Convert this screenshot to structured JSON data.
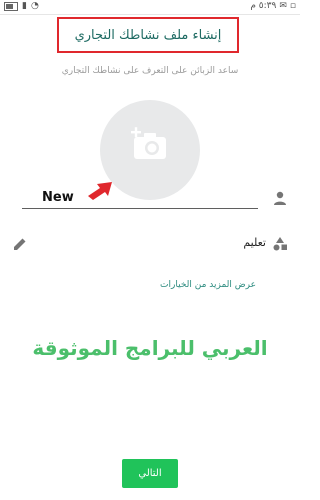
{
  "status_bar": {
    "time": "٥:٣٩ م"
  },
  "header": {
    "title": "إنشاء ملف نشاطك التجاري",
    "subtitle": "ساعد الزبائن على التعرف على نشاطك التجاري"
  },
  "form": {
    "name_value": "New",
    "category": "تعليم",
    "more_options": "عرض المزيد من الخيارات"
  },
  "watermark": "العربي للبرامج الموثوقة",
  "footer": {
    "next_label": "التالي"
  },
  "colors": {
    "title_box_border": "#e0282d",
    "teal_text": "#1e6b63",
    "link": "#2a8a7e",
    "watermark": "#4bbf6b",
    "button": "#20c35a"
  },
  "icons": {
    "photo": "camera-add-icon",
    "name": "person-icon",
    "category": "shapes-icon",
    "edit": "pencil-icon",
    "annotation": "red-arrow-icon"
  }
}
